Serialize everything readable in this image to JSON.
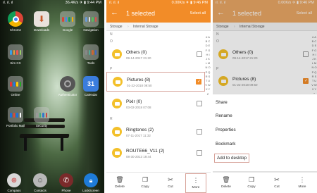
{
  "home": {
    "status_left": "ıl. ıl. ıl",
    "status_right": "36.4K/s ✈ ▮ 9:44 PM",
    "apps": [
      {
        "label": "Chrome",
        "icon": "chrome-icon"
      },
      {
        "label": "Downloads",
        "icon": "downloads-icon"
      },
      {
        "label": "Google",
        "icon": "google-folder-icon"
      },
      {
        "label": "Navigation",
        "icon": "navigation-folder-icon"
      },
      {
        "label": "Tools",
        "icon": "tools-folder-icon"
      },
      {
        "label": "Sim CX",
        "icon": "sim-icon"
      },
      {
        "label": "Online",
        "icon": "online-folder-icon"
      },
      {
        "label": "Authenticator",
        "icon": "authenticator-icon"
      },
      {
        "label": "Calendar",
        "icon": "calendar-icon",
        "badge": "31"
      },
      {
        "label": "Portfolio Mail",
        "icon": "mail-folder-icon"
      },
      {
        "label": "Security",
        "icon": "security-folder-icon"
      }
    ],
    "dock": [
      {
        "label": "Compass",
        "icon": "compass-icon"
      },
      {
        "label": "Contacts",
        "icon": "contacts-icon"
      },
      {
        "label": "Phone",
        "icon": "phone-icon"
      },
      {
        "label": "LockScreen",
        "icon": "lockscreen-icon"
      }
    ]
  },
  "fm": {
    "status_left": "ıl. ıl. ıl",
    "status_right": "0.00K/s ✈ ▮ 9:46 PM",
    "title": "1 selected",
    "select_all": "Select all",
    "crumb_1": "Storage",
    "crumb_2": "Internal Storage",
    "sec_n": "N",
    "sec_o": "O",
    "sec_p": "P",
    "sec_r": "R",
    "others_name": "Others (0)",
    "others_date": "09-14-2017 21:20",
    "pictures_name": "Pictures (8)",
    "pictures_date": "01-22-2018 09:50",
    "pixlr_name": "Pixlr (0)",
    "pixlr_date": "03-02-2018 07:08",
    "ringtones_name": "Ringtones (2)",
    "ringtones_date": "07-11-2017 11:32",
    "route_name": "ROUTE66_V11 (2)",
    "route_date": "08-30-2013 19:44",
    "index_letters": "# A B C D E F G H I J K L M N O P Q R S T U V W X Y Z",
    "toolbar": {
      "delete": "Delete",
      "copy": "Copy",
      "cut": "Cut",
      "more": "More"
    }
  },
  "popup": {
    "share": "Share",
    "rename": "Rename",
    "properties": "Properties",
    "bookmark": "Bookmark",
    "add_desktop": "Add to desktop"
  },
  "colors": {
    "accent": "#f28c28",
    "folder": "#f3c02a",
    "highlight": "#d7a39a"
  }
}
